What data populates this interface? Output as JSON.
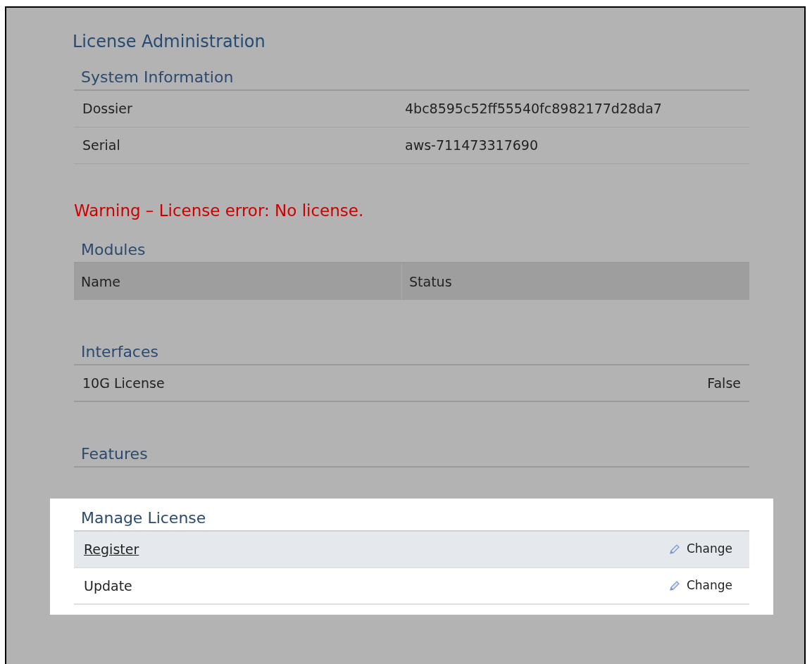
{
  "title": "License Administration",
  "system_information": {
    "heading": "System Information",
    "rows": [
      {
        "label": "Dossier",
        "value": "4bc8595c52ff55540fc8982177d28da7"
      },
      {
        "label": "Serial",
        "value": "aws-711473317690"
      }
    ]
  },
  "warning": "Warning – License error: No license.",
  "modules": {
    "heading": "Modules",
    "columns": [
      "Name",
      "Status"
    ]
  },
  "interfaces": {
    "heading": "Interfaces",
    "rows": [
      {
        "label": "10G License",
        "value": "False"
      }
    ]
  },
  "features": {
    "heading": "Features"
  },
  "manage_license": {
    "heading": "Manage License",
    "rows": [
      {
        "label": "Register",
        "kind": "link",
        "highlighted": true,
        "action": "Change"
      },
      {
        "label": "Update",
        "kind": "text",
        "highlighted": false,
        "action": "Change"
      }
    ]
  }
}
